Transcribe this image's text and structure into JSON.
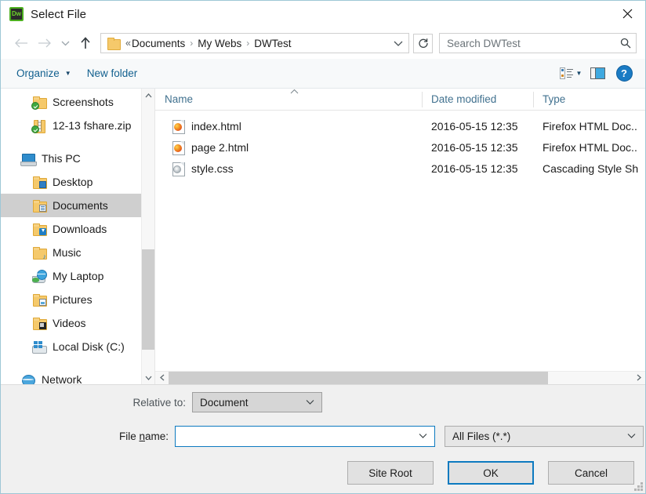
{
  "window": {
    "title": "Select File",
    "app_icon": "Dw",
    "close_label": "×"
  },
  "nav": {
    "back_icon": "←",
    "forward_icon": "→",
    "recent_icon": "⌄",
    "up_icon": "↑",
    "breadcrumb_chevrons": "«",
    "crumbs": [
      "Documents",
      "My Webs",
      "DWTest"
    ],
    "separator": "›",
    "dropdown_icon": "⌄",
    "refresh_icon": "↻",
    "search_placeholder": "Search DWTest",
    "search_value": "",
    "search_icon": "⌕"
  },
  "command_bar": {
    "organize_label": "Organize",
    "organize_caret": "▼",
    "new_folder_label": "New folder",
    "view_caret": "▼"
  },
  "sidebar": {
    "items": [
      {
        "label": "Screenshots",
        "icon": "folder-sync-icon",
        "indent": 1,
        "selected": false
      },
      {
        "label": "12-13 fshare.zip",
        "icon": "zip-sync-icon",
        "indent": 1,
        "selected": false
      },
      {
        "label": "This PC",
        "icon": "this-pc-icon",
        "indent": 0,
        "selected": false,
        "gap_before": true
      },
      {
        "label": "Desktop",
        "icon": "folder-desktop-icon",
        "indent": 1,
        "selected": false
      },
      {
        "label": "Documents",
        "icon": "folder-documents-icon",
        "indent": 1,
        "selected": true
      },
      {
        "label": "Downloads",
        "icon": "folder-downloads-icon",
        "indent": 1,
        "selected": false
      },
      {
        "label": "Music",
        "icon": "folder-music-icon",
        "indent": 1,
        "selected": false
      },
      {
        "label": "My Laptop",
        "icon": "laptop-globe-icon",
        "indent": 1,
        "selected": false
      },
      {
        "label": "Pictures",
        "icon": "folder-pictures-icon",
        "indent": 1,
        "selected": false
      },
      {
        "label": "Videos",
        "icon": "folder-videos-icon",
        "indent": 1,
        "selected": false
      },
      {
        "label": "Local Disk (C:)",
        "icon": "local-disk-icon",
        "indent": 1,
        "selected": false
      },
      {
        "label": "Network",
        "icon": "network-globe-icon",
        "indent": 0,
        "selected": false,
        "gap_before": true
      }
    ],
    "scroll_up_icon": "⌃",
    "scroll_down_icon": "⌄"
  },
  "file_list": {
    "columns": [
      "Name",
      "Date modified",
      "Type"
    ],
    "sort_indicator": "⌃",
    "rows": [
      {
        "name": "index.html",
        "date": "2016-05-15 12:35",
        "type": "Firefox HTML Doc..",
        "icon": "firefox-html-icon"
      },
      {
        "name": "page 2.html",
        "date": "2016-05-15 12:35",
        "type": "Firefox HTML Doc..",
        "icon": "firefox-html-icon"
      },
      {
        "name": "style.css",
        "date": "2016-05-15 12:35",
        "type": "Cascading Style Sh",
        "icon": "css-file-icon"
      }
    ],
    "hscroll_left_icon": "‹",
    "hscroll_right_icon": "›"
  },
  "bottom": {
    "relative_to_label": "Relative to:",
    "relative_to_value": "Document",
    "file_name_label_pre": "File ",
    "file_name_label_acc": "n",
    "file_name_label_post": "ame:",
    "file_name_value": "",
    "file_type_value": "All Files (*.*)",
    "combo_caret": "⌄",
    "site_root_label": "Site Root",
    "ok_label": "OK",
    "cancel_label": "Cancel"
  },
  "colors": {
    "accent_blue": "#0d7ac0",
    "link_blue": "#12608f",
    "header_blue": "#41718f",
    "selection_gray": "#cfcfcf"
  }
}
